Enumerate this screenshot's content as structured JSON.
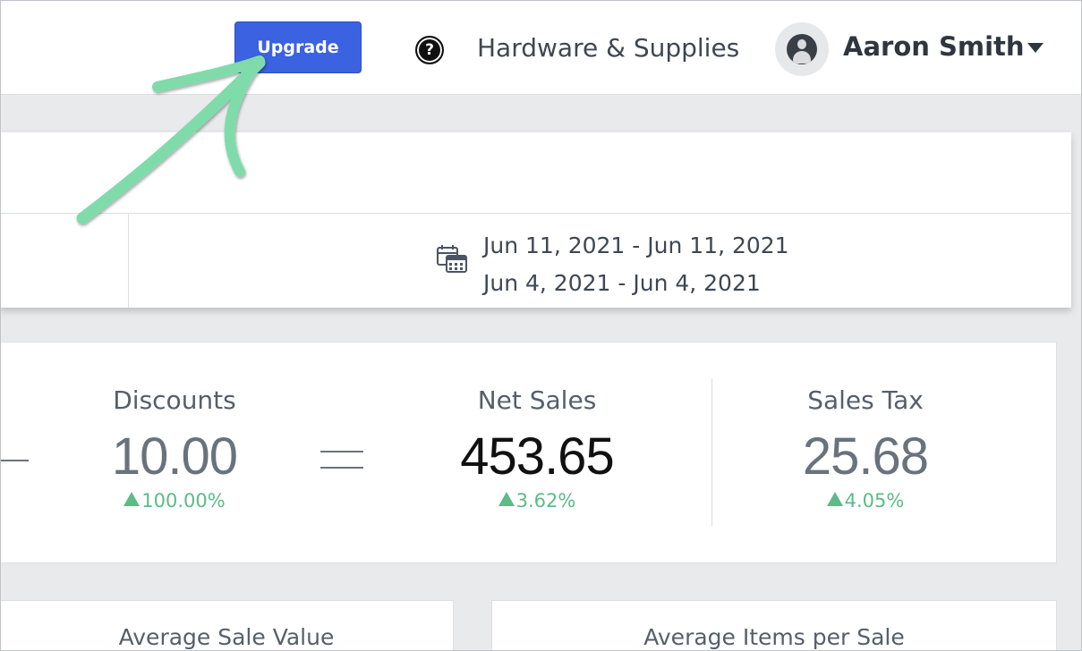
{
  "header": {
    "upgrade_label": "Upgrade",
    "help_symbol": "?",
    "store_name": "Hardware & Supplies",
    "user_name": "Aaron Smith",
    "icons": {
      "help": "help-circle-icon",
      "avatar": "user-avatar-icon",
      "menu": "chevron-down-icon"
    }
  },
  "filters": {
    "current_range": "Jun 11, 2021 - Jun 11, 2021",
    "compare_range": "Jun 4, 2021 - Jun 4, 2021",
    "icon": "calendar-icon"
  },
  "metrics": {
    "discounts": {
      "label": "Discounts",
      "value": "10.00",
      "change": "100.00%"
    },
    "net_sales": {
      "label": "Net Sales",
      "value": "453.65",
      "change": "3.62%"
    },
    "sales_tax": {
      "label": "Sales Tax",
      "value": "25.68",
      "change": "4.05%"
    }
  },
  "cards": {
    "avg_sale_value": "Average Sale Value",
    "avg_items_per_sale": "Average Items per Sale"
  },
  "colors": {
    "upgrade_button": "#3b62e0",
    "positive_change": "#5cbb87",
    "annotation_arrow": "#7fdcaa",
    "page_background": "#e9eaec"
  }
}
